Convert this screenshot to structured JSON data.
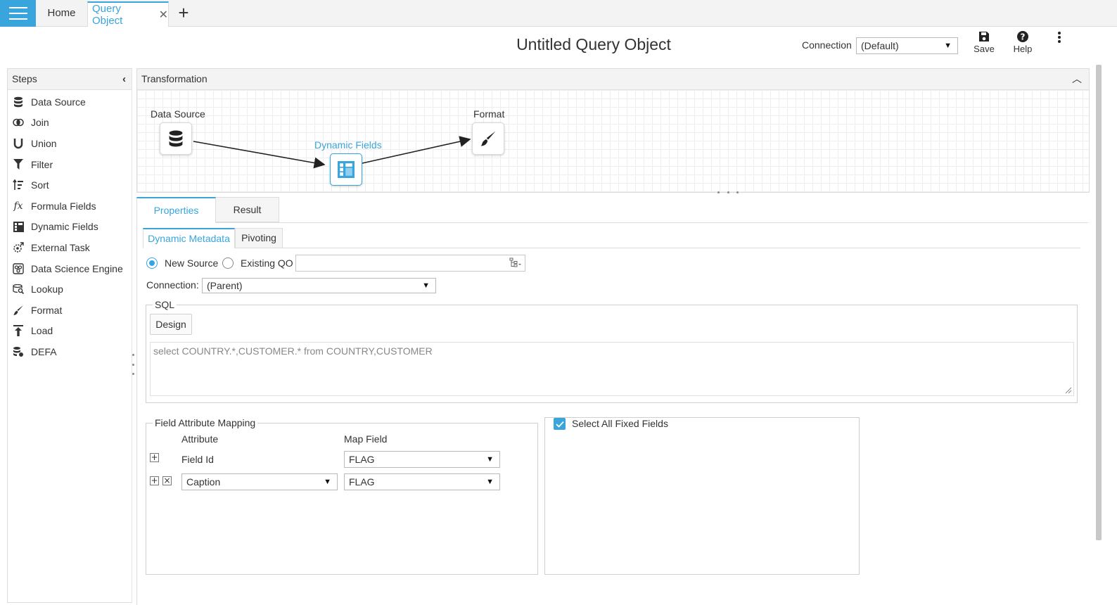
{
  "tabs": {
    "home": "Home",
    "active": "Query Object",
    "close": "✕",
    "add": "+"
  },
  "header": {
    "title": "Untitled Query Object",
    "connection_label": "Connection",
    "connection_value": "(Default)",
    "save_label": "Save",
    "help_label": "Help"
  },
  "steps": {
    "title": "Steps",
    "items": [
      {
        "label": "Data Source",
        "icon": "database-icon"
      },
      {
        "label": "Join",
        "icon": "join-icon"
      },
      {
        "label": "Union",
        "icon": "union-icon"
      },
      {
        "label": "Filter",
        "icon": "filter-icon"
      },
      {
        "label": "Sort",
        "icon": "sort-icon"
      },
      {
        "label": "Formula Fields",
        "icon": "formula-icon"
      },
      {
        "label": "Dynamic Fields",
        "icon": "dynamic-fields-icon"
      },
      {
        "label": "External Task",
        "icon": "external-task-icon"
      },
      {
        "label": "Data Science Engine",
        "icon": "data-science-icon"
      },
      {
        "label": "Lookup",
        "icon": "lookup-icon"
      },
      {
        "label": "Format",
        "icon": "format-brush-icon"
      },
      {
        "label": "Load",
        "icon": "load-icon"
      },
      {
        "label": "DEFA",
        "icon": "defa-icon"
      }
    ]
  },
  "transformation": {
    "title": "Transformation",
    "nodes": {
      "datasource": "Data Source",
      "dynamic": "Dynamic Fields",
      "format": "Format"
    }
  },
  "properties": {
    "tabs": {
      "properties": "Properties",
      "result": "Result"
    },
    "subtabs": {
      "dynamic_metadata": "Dynamic Metadata",
      "pivoting": "Pivoting"
    },
    "new_source": "New Source",
    "existing_qo": "Existing QO",
    "existing_qo_value": "",
    "connection_label": "Connection:",
    "connection_value": "(Parent)",
    "sql_legend": "SQL",
    "design_label": "Design",
    "sql_text": "select COUNTRY.*,CUSTOMER.* from COUNTRY,CUSTOMER",
    "fam_legend": "Field Attribute Mapping",
    "col_attribute": "Attribute",
    "col_map_field": "Map Field",
    "rows": [
      {
        "attribute": "Field Id",
        "map_field": "FLAG"
      },
      {
        "attribute": "Caption",
        "map_field": "FLAG"
      }
    ],
    "select_all_fixed": "Select All Fixed Fields"
  },
  "colors": {
    "accent": "#39a5dc",
    "tabbar": "#f3f3f3"
  }
}
